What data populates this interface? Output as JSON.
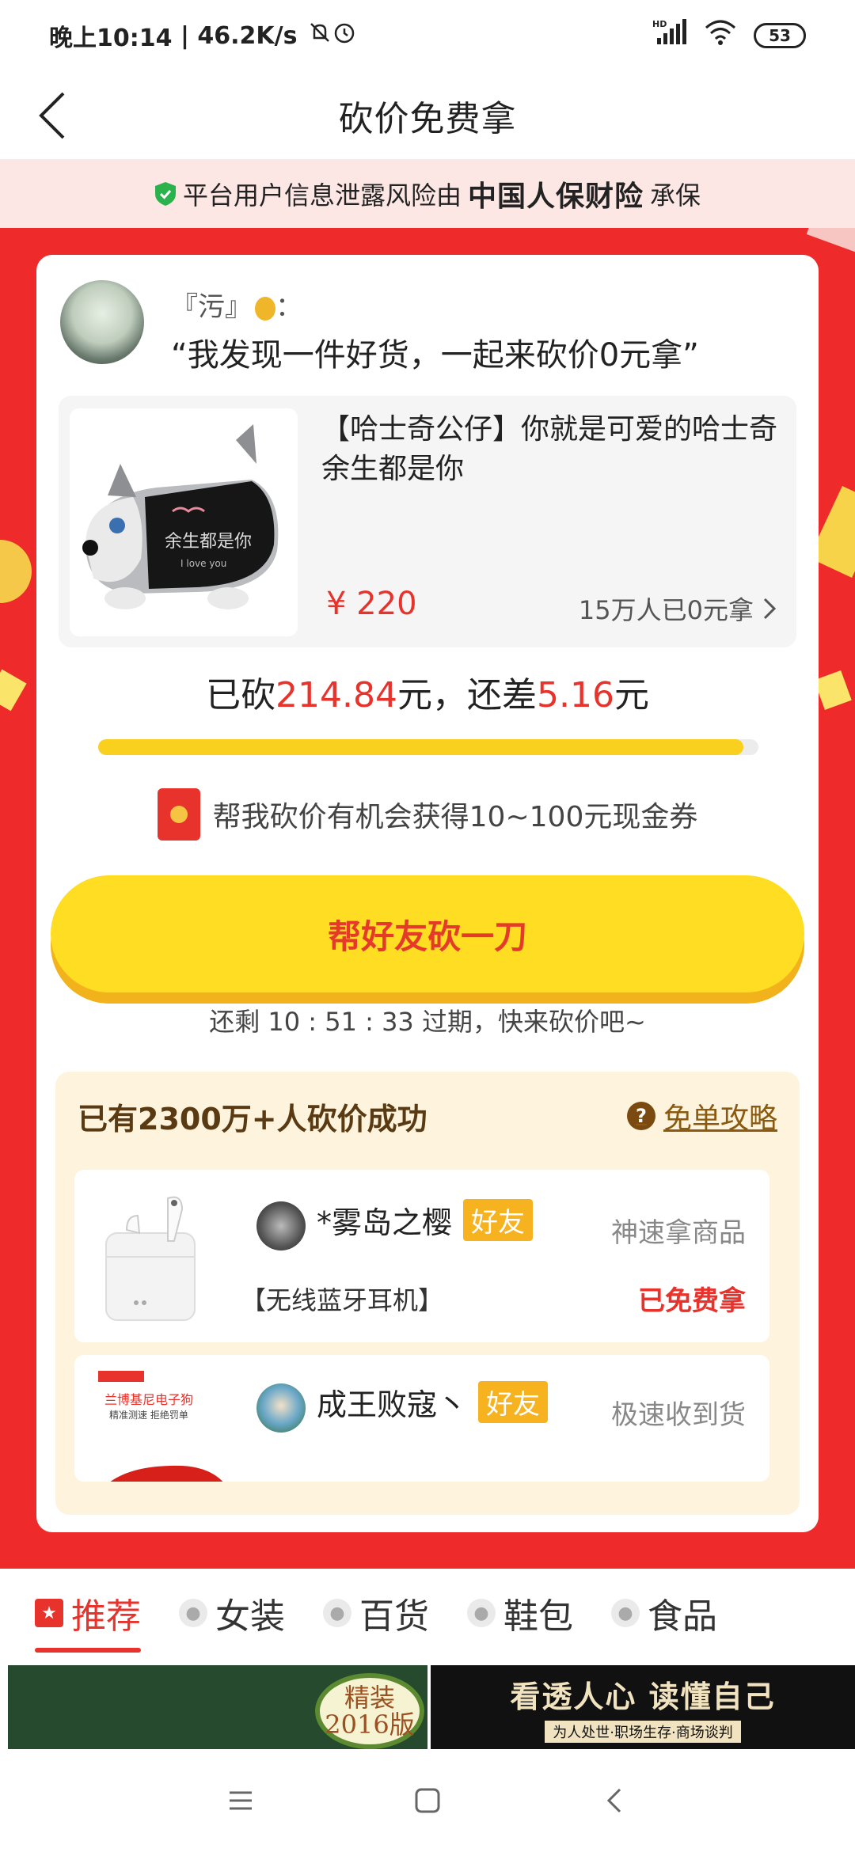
{
  "status": {
    "time": "晚上10:14",
    "speed": "46.2K/s",
    "signal": "HD",
    "battery": "53"
  },
  "header": {
    "title": "砍价免费拿"
  },
  "notice": {
    "text_before": "平台用户信息泄露风险由",
    "company": "中国人保财险",
    "text_after": "承保"
  },
  "inviter": {
    "name": "『污』",
    "colon": "：",
    "quote": "“我发现一件好货，一起来砍价0元拿”"
  },
  "product": {
    "title": "【哈士奇公仔】你就是可爱的哈士奇 余生都是你",
    "price": "¥ 220",
    "sold": "15万人已0元拿",
    "pillow_text": "余生都是你",
    "pillow_sub": "I love you"
  },
  "progress": {
    "prefix": "已砍",
    "cut": "214.84",
    "mid": "元，还差",
    "remain": "5.16",
    "suffix": "元",
    "fraction": 0.977
  },
  "coupon_text": "帮我砍价有机会获得10~100元现金券",
  "cta_label": "帮好友砍一刀",
  "timer_text": "还剩 10 : 51 : 33 过期，快来砍价吧~",
  "board": {
    "title": "已有2300万+人砍价成功",
    "guide_label": "免单攻略",
    "entries": [
      {
        "name": "*雾岛之樱",
        "badge": "好友",
        "tag": "神速拿商品",
        "item": "【无线蓝牙耳机】",
        "status": "已免费拿"
      },
      {
        "name": "成王败寇丶",
        "badge": "好友",
        "tag": "极速收到货",
        "item": "",
        "status": "",
        "img_line1": "兰博基尼电子狗",
        "img_line2": "精准测速 拒绝罚单"
      }
    ]
  },
  "tabs": [
    {
      "label": "推荐",
      "active": true
    },
    {
      "label": "女装",
      "active": false
    },
    {
      "label": "百货",
      "active": false
    },
    {
      "label": "鞋包",
      "active": false
    },
    {
      "label": "食品",
      "active": false
    }
  ],
  "banner": {
    "badge_line1": "精装",
    "badge_line2": "2016版",
    "right_line1": "看透人心 读懂自己",
    "right_line2": "为人处世·职场生存·商场谈判"
  },
  "colors": {
    "brand_red": "#e8322c",
    "cta_yellow": "#ffdd22",
    "progress_yellow": "#f9d01e",
    "board_bg": "#fef3dc"
  }
}
